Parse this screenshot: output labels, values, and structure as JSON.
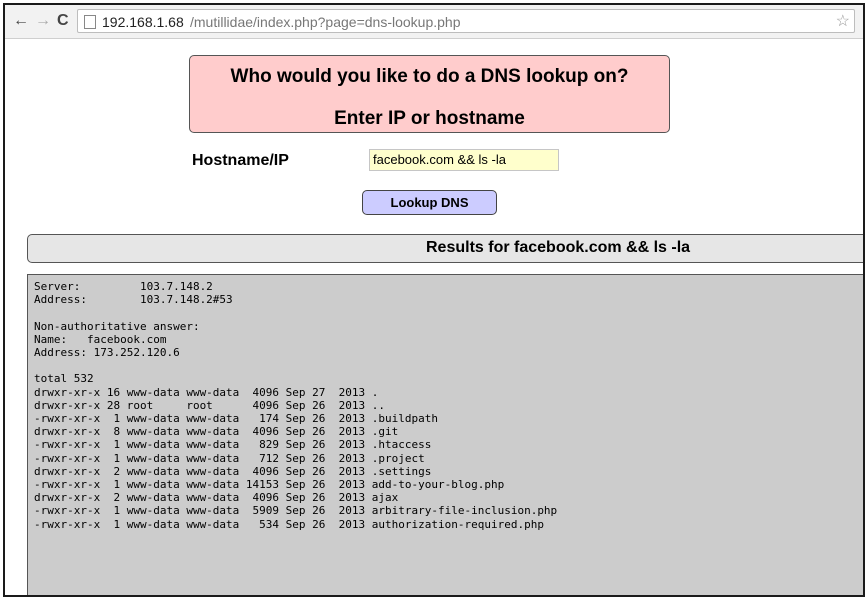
{
  "browser": {
    "back_icon": "←",
    "forward_icon": "→",
    "reload_icon": "C",
    "url_host": "192.168.1.68",
    "url_path": "/mutillidae/index.php?page=dns-lookup.php",
    "star_icon": "☆"
  },
  "hero": {
    "question": "Who would you like to do a DNS lookup on?",
    "instruction": "Enter IP or hostname"
  },
  "form": {
    "host_label": "Hostname/IP",
    "host_value": "facebook.com && ls -la",
    "button_label": "Lookup DNS"
  },
  "results": {
    "title": "Results for facebook.com && ls -la",
    "lines": [
      "Server:         103.7.148.2",
      "Address:        103.7.148.2#53",
      "",
      "Non-authoritative answer:",
      "Name:   facebook.com",
      "Address: 173.252.120.6",
      "",
      "total 532",
      "drwxr-xr-x 16 www-data www-data  4096 Sep 27  2013 .",
      "drwxr-xr-x 28 root     root      4096 Sep 26  2013 ..",
      "-rwxr-xr-x  1 www-data www-data   174 Sep 26  2013 .buildpath",
      "drwxr-xr-x  8 www-data www-data  4096 Sep 26  2013 .git",
      "-rwxr-xr-x  1 www-data www-data   829 Sep 26  2013 .htaccess",
      "-rwxr-xr-x  1 www-data www-data   712 Sep 26  2013 .project",
      "drwxr-xr-x  2 www-data www-data  4096 Sep 26  2013 .settings",
      "-rwxr-xr-x  1 www-data www-data 14153 Sep 26  2013 add-to-your-blog.php",
      "drwxr-xr-x  2 www-data www-data  4096 Sep 26  2013 ajax",
      "-rwxr-xr-x  1 www-data www-data  5909 Sep 26  2013 arbitrary-file-inclusion.php",
      "-rwxr-xr-x  1 www-data www-data   534 Sep 26  2013 authorization-required.php"
    ]
  },
  "colors": {
    "hero_bg": "#ffcccc",
    "input_bg": "#ffffcc",
    "button_bg": "#ccccff",
    "results_bg": "#cccccc"
  }
}
